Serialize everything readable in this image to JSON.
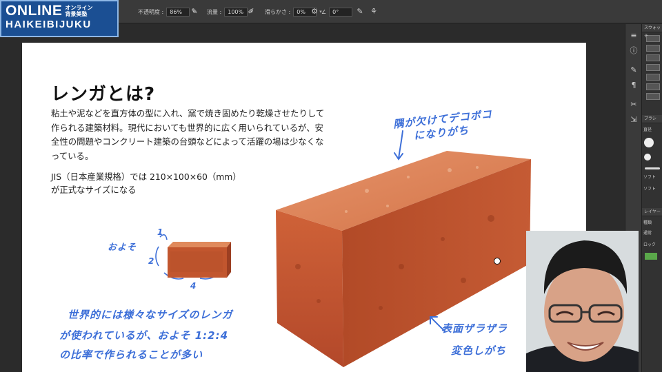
{
  "logo": {
    "main": "ONLINE",
    "jp_line1": "オンライン",
    "jp_line2": "背景美塾",
    "sub": "HAIKEIBIJUKU"
  },
  "options": {
    "opacity_label": "不透明度 :",
    "opacity_value": "86%",
    "flow_label": "流量 :",
    "flow_value": "100%",
    "smooth_label": "滑らかさ :",
    "smooth_value": "0%",
    "angle_value": "0°"
  },
  "document": {
    "title": "レンガとは?",
    "paragraph": "粘土や泥などを直方体の型に入れ、窯で焼き固めたり乾燥させたりして作られる建築材料。現代においても世界的に広く用いられているが、安全性の問題やコンクリート建築の台頭などによって活躍の場は少なくなっている。",
    "spec_line1": "JIS（日本産業規格）では 210×100×60（mm）",
    "spec_line2": "が正式なサイズになる"
  },
  "annotations": {
    "corner_line1": "隅が欠けてデコボコ",
    "corner_line2": "になりがち",
    "approx": "およそ",
    "dim1": "1",
    "dim2": "2",
    "dim4": "4",
    "sizes_line1": "世界的には様々なサイズのレンガ",
    "sizes_line2": "が使われているが、およそ 1:2:4",
    "sizes_line3": "の比率で作られることが多い",
    "surface_line1": "表面ザラザラ",
    "surface_line2": "変色しがち"
  },
  "panels": {
    "swatches_tab": "スウォッチ",
    "brush_tab": "ブラシ",
    "brush_size_label": "直径",
    "soft1": "ソフト",
    "soft2": "ソフト",
    "layers_tab": "レイヤー",
    "layer_kind": "種類",
    "layer_mode": "通常",
    "lock_label": "ロック"
  },
  "colors": {
    "accent_blue": "#3d6fd8",
    "brick": "#c2562e",
    "logo_bg": "#1b4f93"
  }
}
